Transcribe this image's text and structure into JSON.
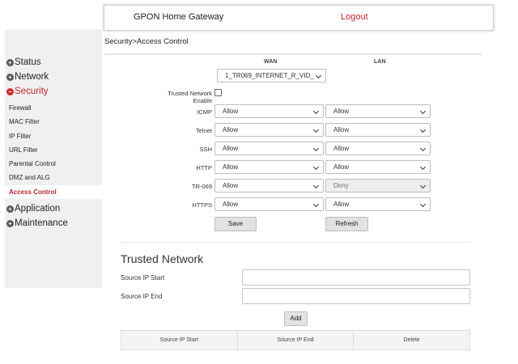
{
  "header": {
    "title": "GPON Home Gateway",
    "logout": "Logout"
  },
  "breadcrumb": "Security>Access Control",
  "sidebar": {
    "status": "Status",
    "network": "Network",
    "security": "Security",
    "security_items": [
      "Firewall",
      "MAC Filter",
      "IP Filter",
      "URL Filter",
      "Parental Control",
      "DMZ and ALG",
      "Access Control"
    ],
    "application": "Application",
    "maintenance": "Maintenance"
  },
  "access": {
    "wan_header": "WAN",
    "lan_header": "LAN",
    "wan_interface": "1_TR069_INTERNET_R_VID_",
    "trusted_label": "Trusted Network Enable",
    "rows": [
      {
        "label": "ICMP",
        "wan": "Allow",
        "lan": "Allow"
      },
      {
        "label": "Telnet",
        "wan": "Allow",
        "lan": "Allow"
      },
      {
        "label": "SSH",
        "wan": "Allow",
        "lan": "Allow"
      },
      {
        "label": "HTTP",
        "wan": "Allow",
        "lan": "Allow"
      },
      {
        "label": "TR-069",
        "wan": "Allow",
        "lan": "Deny"
      },
      {
        "label": "HTTPS",
        "wan": "Allow",
        "lan": "Allow"
      }
    ],
    "save": "Save",
    "refresh": "Refresh"
  },
  "trusted": {
    "title": "Trusted Network",
    "start_label": "Source IP Start",
    "end_label": "Source IP End",
    "add": "Add",
    "columns": [
      "Source IP Start",
      "Source IP End",
      "Delete"
    ]
  }
}
